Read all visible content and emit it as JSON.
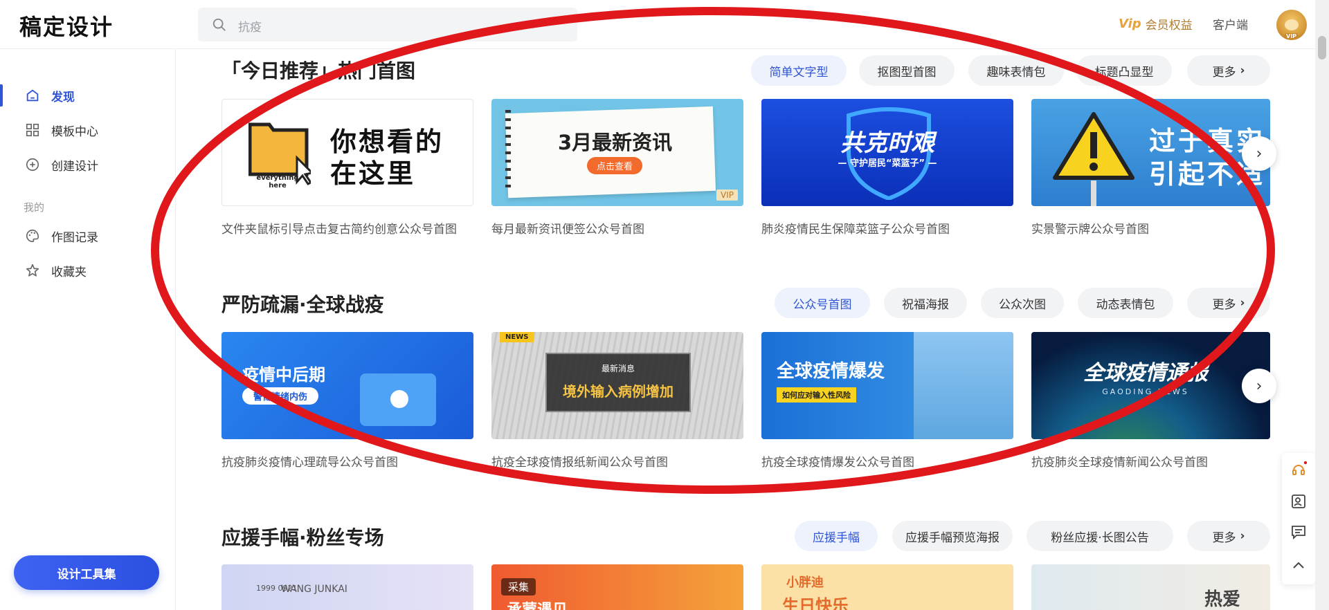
{
  "header": {
    "logo": "稿定设计",
    "search_placeholder": "抗疫",
    "vip_label": "会员权益",
    "vip_mark": "Vip",
    "client_label": "客户端",
    "avatar_badge": "VIP"
  },
  "sidebar": {
    "items": [
      {
        "label": "发现",
        "icon": "home-icon",
        "active": true
      },
      {
        "label": "模板中心",
        "icon": "grid-icon"
      },
      {
        "label": "创建设计",
        "icon": "plus-circle-icon"
      }
    ],
    "section_label": "我的",
    "my_items": [
      {
        "label": "作图记录",
        "icon": "palette-icon"
      },
      {
        "label": "收藏夹",
        "icon": "star-icon"
      }
    ],
    "tool_button": "设计工具集"
  },
  "sections": [
    {
      "title": "「今日推荐」热门首图",
      "chips": [
        "简单文字型",
        "抠图型首图",
        "趣味表情包",
        "标题凸显型",
        "更多"
      ],
      "cards": [
        {
          "caption": "文件夹鼠标引导点击复古简约创意公众号首图",
          "text1": "你想看的",
          "text2": "在这里",
          "sub": "everything here"
        },
        {
          "caption": "每月最新资讯便签公众号首图",
          "text1": "3月最新资讯",
          "text2": "点击查看",
          "vip": "VIP"
        },
        {
          "caption": "肺炎疫情民生保障菜篮子公众号首图",
          "text1": "共克时艰",
          "text2": "— 守护居民“菜篮子” —"
        },
        {
          "caption": "实景警示牌公众号首图",
          "text1": "过于真实",
          "text2": "引起不适"
        }
      ]
    },
    {
      "title": "严防疏漏·全球战疫",
      "chips": [
        "公众号首图",
        "祝福海报",
        "公众次图",
        "动态表情包",
        "更多"
      ],
      "cards": [
        {
          "caption": "抗疫肺炎疫情心理疏导公众号首图",
          "text1": "疫情中后期",
          "text2": "警惕情绪内伤"
        },
        {
          "caption": "抗疫全球疫情报纸新闻公众号首图",
          "text1": "最新消息",
          "text2": "境外输入病例增加",
          "badge": "NEWS"
        },
        {
          "caption": "抗疫全球疫情爆发公众号首图",
          "text1": "全球疫情爆发",
          "text2": "如何应对输入性风险"
        },
        {
          "caption": "抗疫肺炎全球疫情新闻公众号首图",
          "text1": "全球疫情通报",
          "text2": "GAODING NEWS"
        }
      ]
    },
    {
      "title": "应援手幅·粉丝专场",
      "chips": [
        "应援手幅",
        "应援手幅预览海报",
        "粉丝应援·长图公告",
        "更多"
      ],
      "cards": [
        {
          "text1": "1999 0921",
          "text2": "WANG JUNKAI"
        },
        {
          "text1": "采集",
          "text2": "承蒙遇见"
        },
        {
          "text1": "小胖迪",
          "text2": "生日快乐"
        },
        {
          "text1": "热爱",
          "text2": ""
        }
      ]
    }
  ],
  "colors": {
    "accent": "#2f55d4",
    "annotation": "#e0181b"
  }
}
